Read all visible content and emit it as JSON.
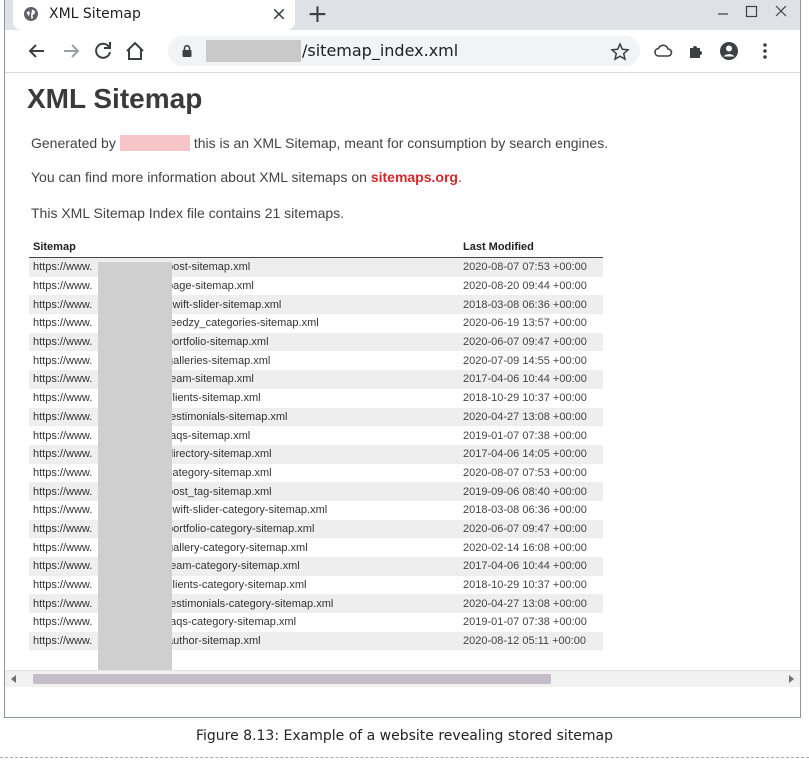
{
  "browser": {
    "tab_title": "XML Sitemap",
    "tab_close": "×",
    "new_tab": "+",
    "url_path": "/sitemap_index.xml"
  },
  "page": {
    "title": "XML Sitemap",
    "generated_prefix": "Generated by",
    "generated_suffix": "this is an XML Sitemap, meant for consumption by search engines.",
    "info_prefix": "You can find more information about XML sitemaps on",
    "info_link": "sitemaps.org",
    "info_suffix": ".",
    "count_text": "This XML Sitemap Index file contains 21 sitemaps."
  },
  "table": {
    "col_sitemap": "Sitemap",
    "col_modified": "Last Modified",
    "url_prefix": "https://www.",
    "rows": [
      {
        "path": "/post-sitemap.xml",
        "modified": "2020-08-07 07:53 +00:00"
      },
      {
        "path": "/page-sitemap.xml",
        "modified": "2020-08-20 09:44 +00:00"
      },
      {
        "path": "/swift-slider-sitemap.xml",
        "modified": "2018-03-08 06:36 +00:00"
      },
      {
        "path": "/feedzy_categories-sitemap.xml",
        "modified": "2020-06-19 13:57 +00:00"
      },
      {
        "path": "/portfolio-sitemap.xml",
        "modified": "2020-06-07 09:47 +00:00"
      },
      {
        "path": "/galleries-sitemap.xml",
        "modified": "2020-07-09 14:55 +00:00"
      },
      {
        "path": "/team-sitemap.xml",
        "modified": "2017-04-06 10:44 +00:00"
      },
      {
        "path": "/clients-sitemap.xml",
        "modified": "2018-10-29 10:37 +00:00"
      },
      {
        "path": "/testimonials-sitemap.xml",
        "modified": "2020-04-27 13:08 +00:00"
      },
      {
        "path": "/faqs-sitemap.xml",
        "modified": "2019-01-07 07:38 +00:00"
      },
      {
        "path": "/directory-sitemap.xml",
        "modified": "2017-04-06 14:05 +00:00"
      },
      {
        "path": "/category-sitemap.xml",
        "modified": "2020-08-07 07:53 +00:00"
      },
      {
        "path": "/post_tag-sitemap.xml",
        "modified": "2019-09-06 08:40 +00:00"
      },
      {
        "path": "/swift-slider-category-sitemap.xml",
        "modified": "2018-03-08 06:36 +00:00"
      },
      {
        "path": "/portfolio-category-sitemap.xml",
        "modified": "2020-06-07 09:47 +00:00"
      },
      {
        "path": "/gallery-category-sitemap.xml",
        "modified": "2020-02-14 16:08 +00:00"
      },
      {
        "path": "/team-category-sitemap.xml",
        "modified": "2017-04-06 10:44 +00:00"
      },
      {
        "path": "/clients-category-sitemap.xml",
        "modified": "2018-10-29 10:37 +00:00"
      },
      {
        "path": "/testimonials-category-sitemap.xml",
        "modified": "2020-04-27 13:08 +00:00"
      },
      {
        "path": "/faqs-category-sitemap.xml",
        "modified": "2019-01-07 07:38 +00:00"
      },
      {
        "path": "/author-sitemap.xml",
        "modified": "2020-08-12 05:11 +00:00"
      }
    ]
  },
  "caption": "Figure 8.13: Example of a website revealing stored sitemap",
  "colors": {
    "link_red": "#d6282b",
    "tabstrip": "#dee1e6",
    "omnibox": "#f1f3f4",
    "redaction_gray": "#cfcfcf",
    "redaction_pink": "#f7c5c8"
  },
  "icons": [
    "globe-favicon-icon",
    "close-icon",
    "plus-icon",
    "minimize-icon",
    "maximize-icon",
    "window-close-icon",
    "back-arrow-icon",
    "forward-arrow-icon",
    "reload-icon",
    "home-icon",
    "lock-icon",
    "star-icon",
    "cloud-icon",
    "puzzle-extension-icon",
    "account-icon",
    "kebab-menu-icon"
  ]
}
